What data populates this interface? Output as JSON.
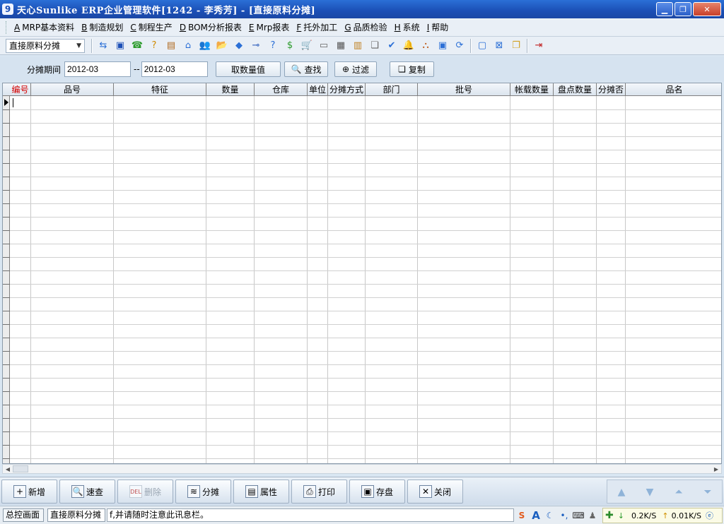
{
  "window": {
    "title": "天心Sunlike ERP企业管理软件[1242 - 李秀芳] - [直接原料分摊]",
    "logo_glyph": "9",
    "minimize": "▁",
    "maximize": "❐",
    "close": "✕"
  },
  "menu": [
    {
      "key": "A",
      "label": "MRP基本资料"
    },
    {
      "key": "B",
      "label": "制造规划"
    },
    {
      "key": "C",
      "label": "制程生产"
    },
    {
      "key": "D",
      "label": "BOM分析报表"
    },
    {
      "key": "E",
      "label": "Mrp报表"
    },
    {
      "key": "F",
      "label": "托外加工"
    },
    {
      "key": "G",
      "label": "品质检验"
    },
    {
      "key": "H",
      "label": "系统"
    },
    {
      "key": "I",
      "label": "帮助"
    }
  ],
  "toolbar": {
    "module_select": "直接原料分摊",
    "icons": [
      "transfer-icon",
      "monitor-icon",
      "phone-icon",
      "question-folder-icon",
      "briefcase-icon",
      "home-icon",
      "people-icon",
      "open-folder-icon",
      "bookmark-icon",
      "arrow-key-icon",
      "help-icon",
      "dollar-icon",
      "cart-icon",
      "document-icon",
      "calculator-icon",
      "cabinet-icon",
      "copy-icon",
      "check-icon",
      "bell-icon",
      "hierarchy-icon",
      "computer-icon",
      "refresh-icon",
      "window-icon",
      "close-window-icon",
      "cascade-icon",
      "exit-icon"
    ],
    "glyphs": [
      "⇆",
      "▣",
      "☎",
      "?",
      "▤",
      "⌂",
      "👥",
      "📂",
      "◆",
      "⊸",
      "?",
      "$",
      "🛒",
      "▭",
      "▦",
      "▥",
      "❏",
      "✔",
      "🔔",
      "⛬",
      "▣",
      "⟳",
      "▢",
      "⊠",
      "❐",
      "⇥"
    ]
  },
  "filter": {
    "period_label": "分摊期间",
    "from": "2012-03",
    "separator": "--",
    "to": "2012-03",
    "get_qty": "取数量值",
    "find": "查找",
    "filter": "过滤",
    "copy": "复制"
  },
  "table": {
    "columns": [
      "编号",
      "品号",
      "特征",
      "数量",
      "仓库",
      "单位",
      "分摊方式",
      "部门",
      "批号",
      "帐载数量",
      "盘点数量",
      "分摊否",
      "品名"
    ],
    "rows": []
  },
  "actions": {
    "add": "新增",
    "quick_find": "速查",
    "delete": "删除",
    "delete_icon_text": "DEL",
    "allocate": "分摊",
    "properties": "属性",
    "print": "打印",
    "save": "存盘",
    "close": "关闭"
  },
  "status": {
    "tab_main": "总控画面",
    "tab_current": "直接原料分摊",
    "message": "f,并请随时注意此讯息栏。",
    "download_speed": "0.2K/S",
    "upload_speed": "0.01K/S"
  },
  "colors": {
    "title_bar": "#1b4fb6",
    "key_column_header": "#d40000",
    "background": "#d9e6f2"
  }
}
